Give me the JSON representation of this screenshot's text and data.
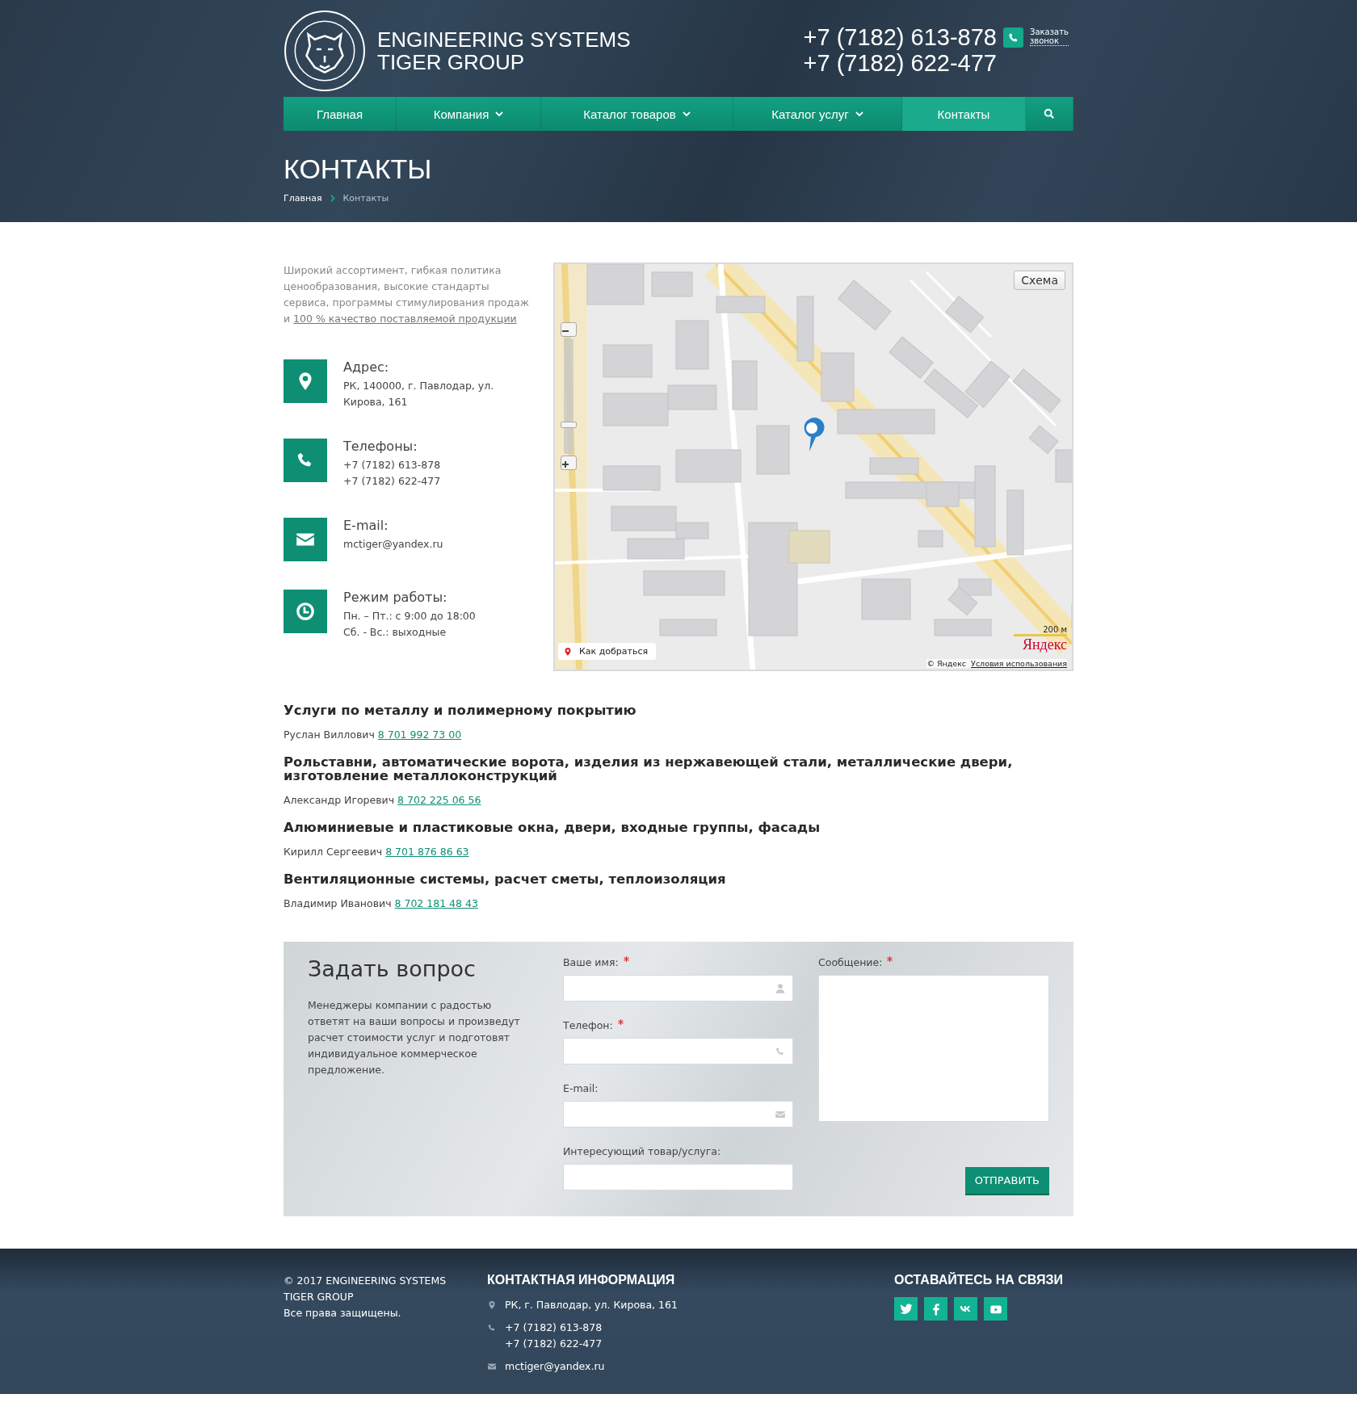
{
  "header": {
    "logo_lines": [
      "ENGINEERING SYSTEMS",
      "TIGER GROUP"
    ],
    "phones": [
      "+7 (7182) 613-878",
      "+7 (7182) 622-477"
    ],
    "callback": "Заказать звонок"
  },
  "nav": [
    {
      "label": "Главная",
      "dropdown": false,
      "selected": false
    },
    {
      "label": "Компания",
      "dropdown": true,
      "selected": false
    },
    {
      "label": "Каталог товаров",
      "dropdown": true,
      "selected": false
    },
    {
      "label": "Каталог услуг",
      "dropdown": true,
      "selected": false
    },
    {
      "label": "Контакты",
      "dropdown": false,
      "selected": true
    }
  ],
  "page_title": "КОНТАКТЫ",
  "breadcrumbs": [
    "Главная",
    "Контакты"
  ],
  "intro": {
    "text": "Широкий ассортимент, гибкая политика ценообразования, высокие стандарты сервиса, программы стимулирования продаж и",
    "link": "100 % качество поставляемой продукции"
  },
  "contacts": [
    {
      "kind": "address",
      "label": "Адрес:",
      "lines": [
        "РК, 140000, г. Павлодар, ул. Кирова, 161"
      ]
    },
    {
      "kind": "phone",
      "label": "Телефоны:",
      "lines": [
        "+7 (7182) 613-878",
        "+7 (7182) 622-477"
      ]
    },
    {
      "kind": "email",
      "label": "E-mail:",
      "lines": [
        "mctiger@yandex.ru"
      ]
    },
    {
      "kind": "hours",
      "label": "Режим работы:",
      "lines": [
        "Пн. – Пт.: с 9:00 до 18:00",
        "Сб. - Вс.: выходные"
      ]
    }
  ],
  "map": {
    "zoom": {
      "level": 0.25
    },
    "layer_button": "Схема",
    "route_button": "Как добраться",
    "scale": "200 м",
    "logo": "Яндекс",
    "copyright": "© Яндекс",
    "terms": "Условия использования"
  },
  "services": [
    {
      "title": "Услуги по металлу и полимерному покрытию",
      "person": "Руслан Виллович",
      "phone": "8 701 992 73 00"
    },
    {
      "title": "Рольставни, автоматические ворота, изделия из нержавеющей стали, металлические двери, изготовление металлоконструкций",
      "person": "Александр Игоревич",
      "phone": "8 702 225 06 56"
    },
    {
      "title": "Алюминиевые и пластиковые окна, двери, входные группы, фасады",
      "person": "Кирилл Сергеевич",
      "phone": "8 701 876 86 63"
    },
    {
      "title": "Вентиляционные системы, расчет сметы, теплоизоляция",
      "person": "Владимир Иванович",
      "phone": "8 702 181 48 43"
    }
  ],
  "form": {
    "title": "Задать вопрос",
    "text": "Менеджеры компании с радостью ответят на ваши вопросы и произведут расчет стоимости услуг и подготовят индивидуальное коммерческое предложение.",
    "fields": [
      {
        "label": "Ваше имя:",
        "required": true,
        "kind": "name"
      },
      {
        "label": "Телефон:",
        "required": true,
        "kind": "phone"
      },
      {
        "label": "E-mail:",
        "required": false,
        "kind": "email"
      },
      {
        "label": "Интересующий товар/услуга:",
        "required": false,
        "kind": "text"
      }
    ],
    "message": {
      "label": "Сообщение:",
      "required": true
    },
    "submit": "ОТПРАВИТЬ"
  },
  "footer": {
    "copyright": [
      "© 2017 ENGINEERING SYSTEMS",
      "TIGER GROUP",
      "Все права защищены."
    ],
    "contact_heading": "КОНТАКТНАЯ ИНФОРМАЦИЯ",
    "contacts": [
      {
        "kind": "address",
        "lines": [
          "РК, г. Павлодар, ул. Кирова, 161"
        ]
      },
      {
        "kind": "phone",
        "lines": [
          "+7 (7182) 613-878",
          "+7 (7182) 622-477"
        ]
      },
      {
        "kind": "email",
        "lines": [
          "mctiger@yandex.ru"
        ]
      }
    ],
    "social_heading": "ОСТАВАЙТЕСЬ НА СВЯЗИ",
    "socials": [
      {
        "kind": "twitter"
      },
      {
        "kind": "facebook"
      },
      {
        "kind": "vk"
      },
      {
        "kind": "youtube"
      }
    ]
  }
}
